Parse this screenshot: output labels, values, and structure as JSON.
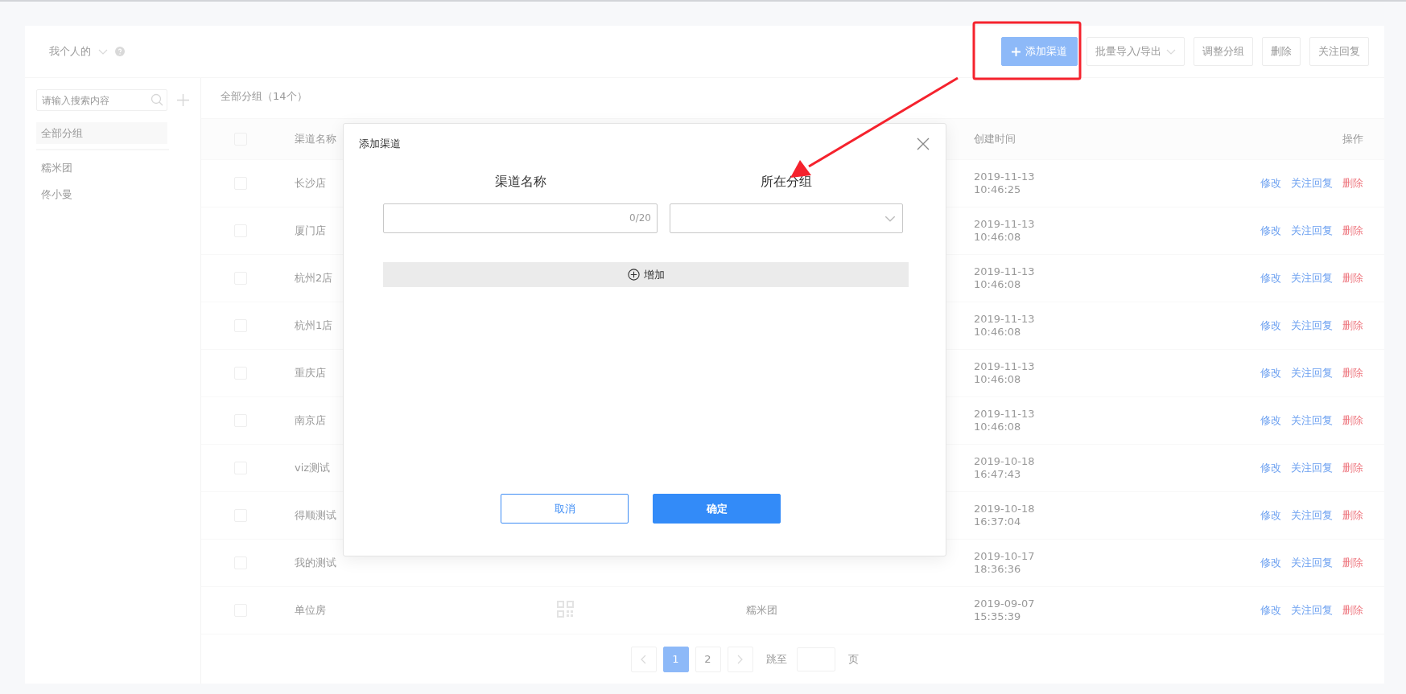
{
  "header": {
    "account": "我个人的",
    "buttons": [
      {
        "label": "添加渠道",
        "kind": "primary"
      },
      {
        "label": "批量导入/导出",
        "kind": "dropdown"
      },
      {
        "label": "调整分组",
        "kind": "plain"
      },
      {
        "label": "删除",
        "kind": "plain"
      },
      {
        "label": "关注回复",
        "kind": "plain"
      }
    ]
  },
  "sidebar": {
    "search": {
      "placeholder": "请输入搜索内容"
    },
    "groups": [
      {
        "label": "全部分组",
        "selected": true
      },
      {
        "label": "糯米团",
        "selected": false
      },
      {
        "label": "佟小曼",
        "selected": false
      }
    ]
  },
  "list_title": "全部分组（14个）",
  "table": {
    "all_checked": false,
    "columns": {
      "name": "渠道名称",
      "created": "创建时间",
      "actions": "操作"
    },
    "rows": [
      {
        "checked": false,
        "name": "长沙店",
        "created_date": "2019-11-13",
        "created_time": "10:46:25",
        "actions": [
          {
            "label": "修改",
            "kind": "link"
          },
          {
            "label": "关注回复",
            "kind": "link"
          },
          {
            "label": "删除",
            "kind": "danger"
          }
        ]
      },
      {
        "checked": false,
        "name": "厦门店",
        "created_date": "2019-11-13",
        "created_time": "10:46:08",
        "actions": [
          {
            "label": "修改",
            "kind": "link"
          },
          {
            "label": "关注回复",
            "kind": "link"
          },
          {
            "label": "删除",
            "kind": "danger"
          }
        ]
      },
      {
        "checked": false,
        "name": "杭州2店",
        "created_date": "2019-11-13",
        "created_time": "10:46:08",
        "actions": [
          {
            "label": "修改",
            "kind": "link"
          },
          {
            "label": "关注回复",
            "kind": "link"
          },
          {
            "label": "删除",
            "kind": "danger"
          }
        ]
      },
      {
        "checked": false,
        "name": "杭州1店",
        "created_date": "2019-11-13",
        "created_time": "10:46:08",
        "actions": [
          {
            "label": "修改",
            "kind": "link"
          },
          {
            "label": "关注回复",
            "kind": "link"
          },
          {
            "label": "删除",
            "kind": "danger"
          }
        ]
      },
      {
        "checked": false,
        "name": "重庆店",
        "created_date": "2019-11-13",
        "created_time": "10:46:08",
        "actions": [
          {
            "label": "修改",
            "kind": "link"
          },
          {
            "label": "关注回复",
            "kind": "link"
          },
          {
            "label": "删除",
            "kind": "danger"
          }
        ]
      },
      {
        "checked": false,
        "name": "南京店",
        "created_date": "2019-11-13",
        "created_time": "10:46:08",
        "actions": [
          {
            "label": "修改",
            "kind": "link"
          },
          {
            "label": "关注回复",
            "kind": "link"
          },
          {
            "label": "删除",
            "kind": "danger"
          }
        ]
      },
      {
        "checked": false,
        "name": "viz测试",
        "created_date": "2019-10-18",
        "created_time": "16:47:43",
        "actions": [
          {
            "label": "修改",
            "kind": "link"
          },
          {
            "label": "关注回复",
            "kind": "link"
          },
          {
            "label": "删除",
            "kind": "danger"
          }
        ]
      },
      {
        "checked": false,
        "name": "得顺测试",
        "created_date": "2019-10-18",
        "created_time": "16:37:04",
        "actions": [
          {
            "label": "修改",
            "kind": "link"
          },
          {
            "label": "关注回复",
            "kind": "link"
          },
          {
            "label": "删除",
            "kind": "danger"
          }
        ]
      },
      {
        "checked": false,
        "name": "我的测试",
        "created_date": "2019-10-17",
        "created_time": "18:36:36",
        "actions": [
          {
            "label": "修改",
            "kind": "link"
          },
          {
            "label": "关注回复",
            "kind": "link"
          },
          {
            "label": "删除",
            "kind": "danger"
          }
        ]
      },
      {
        "checked": false,
        "name": "单位房",
        "qr_code": true,
        "group": "糯米团",
        "created_date": "2019-09-07",
        "created_time": "15:35:39",
        "actions": [
          {
            "label": "修改",
            "kind": "link"
          },
          {
            "label": "关注回复",
            "kind": "link"
          },
          {
            "label": "删除",
            "kind": "danger"
          }
        ]
      }
    ]
  },
  "pagination": {
    "pages": [
      {
        "label": "1",
        "selected": true
      },
      {
        "label": "2",
        "selected": false
      }
    ],
    "jump_label": "跳至",
    "page_suffix": "页"
  },
  "modal": {
    "title": "添加渠道",
    "field_labels": [
      "渠道名称",
      "所在分组"
    ],
    "name_counter": "0/20",
    "add_button": "增加",
    "buttons": [
      {
        "label": "取消",
        "kind": "secondary"
      },
      {
        "label": "确定",
        "kind": "primary"
      }
    ]
  }
}
